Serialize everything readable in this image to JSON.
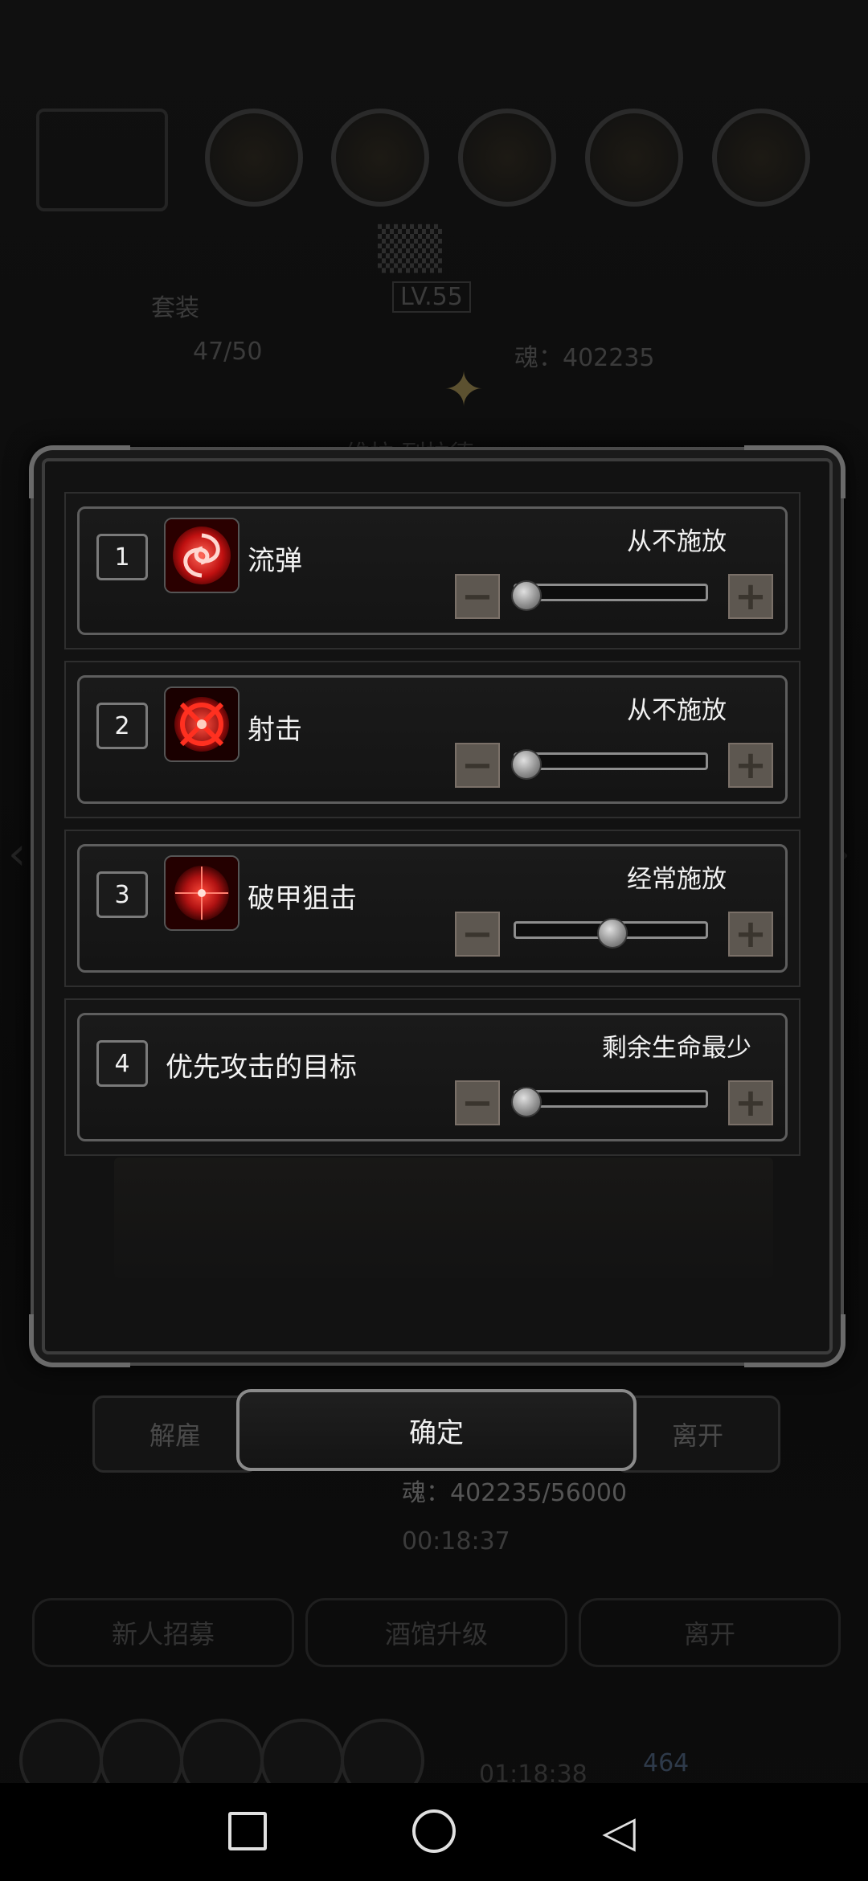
{
  "background": {
    "level": "LV.55",
    "tab_label": "套装",
    "capacity": "47/50",
    "hero_name": "维拉·列拉德",
    "soul_top": "魂：402235",
    "soul_line": "魂：402235/56000",
    "timer": "00:18:37",
    "dismiss_label": "解雇",
    "leave_label": "离开",
    "bottom_tabs": [
      "新人招募",
      "酒馆升级",
      "离开"
    ],
    "bottom_timer": "01:18:38",
    "gem_count": "464"
  },
  "dialog": {
    "rows": [
      {
        "index": "1",
        "name": "流弹",
        "frequency": "从不施放",
        "slider_value": 0,
        "icon": "swirl-skill-icon"
      },
      {
        "index": "2",
        "name": "射击",
        "frequency": "从不施放",
        "slider_value": 0,
        "icon": "crosshair-skill-icon"
      },
      {
        "index": "3",
        "name": "破甲狙击",
        "frequency": "经常施放",
        "slider_value": 0.5,
        "icon": "target-skill-icon"
      },
      {
        "index": "4",
        "name": "优先攻击的目标",
        "frequency": "剩余生命最少",
        "slider_value": 0
      }
    ],
    "confirm_label": "确定"
  },
  "icons": {
    "minus": "−",
    "plus": "+",
    "nav_back": "◁"
  },
  "colors": {
    "skill_red": "#e01818",
    "stepper": "#5d5750"
  }
}
